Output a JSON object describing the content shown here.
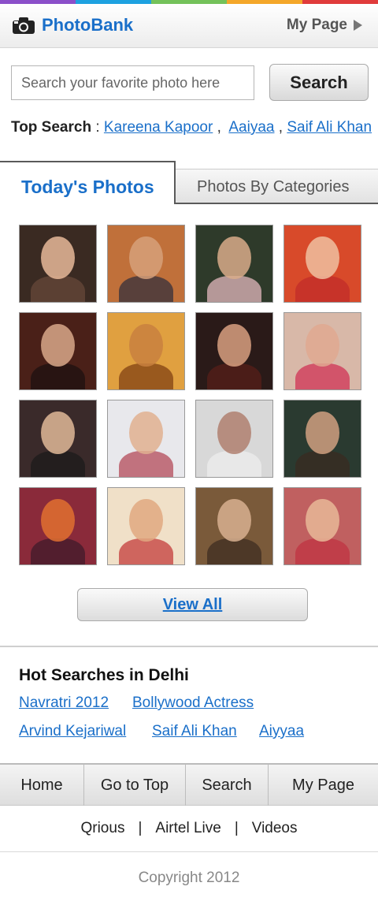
{
  "top_strip_colors": [
    "#8b4fc9",
    "#1da1e0",
    "#74c25a",
    "#f4a72a",
    "#e03b3b"
  ],
  "header": {
    "brand": "PhotoBank",
    "my_page": "My Page"
  },
  "search": {
    "placeholder": "Search your favorite photo here",
    "button_label": "Search"
  },
  "top_search": {
    "label": "Top Search",
    "colon": ":",
    "terms": [
      "Kareena Kapoor",
      "Aaiyaa",
      "Saif Ali Khan"
    ]
  },
  "tabs": [
    {
      "label": "Today's Photos",
      "active": true
    },
    {
      "label": "Photos By Categories",
      "active": false
    }
  ],
  "photos": [
    {
      "bg": "#3a2a22",
      "face": "#e8b999",
      "body": "#6a4a3a"
    },
    {
      "bg": "#c0703a",
      "face": "#d6a07a",
      "body": "#2c2c3c"
    },
    {
      "bg": "#2e3a2a",
      "face": "#d8ab8a",
      "body": "#f0c0c8"
    },
    {
      "bg": "#d84a2a",
      "face": "#f0c0a0",
      "body": "#c02a2a"
    },
    {
      "bg": "#4a2018",
      "face": "#d8a88a",
      "body": "#1a1010"
    },
    {
      "bg": "#e0a040",
      "face": "#c88040",
      "body": "#7a3a10"
    },
    {
      "bg": "#2a1a18",
      "face": "#d8a080",
      "body": "#5a2018"
    },
    {
      "bg": "#d8b8a8",
      "face": "#e0a890",
      "body": "#d02a50"
    },
    {
      "bg": "#3a2a2a",
      "face": "#e0b898",
      "body": "#1a1a1a"
    },
    {
      "bg": "#e8e8ec",
      "face": "#e0b090",
      "body": "#b04050"
    },
    {
      "bg": "#d8d8d8",
      "face": "#b08070",
      "body": "#f0f0f0"
    },
    {
      "bg": "#2a3a30",
      "face": "#d0a080",
      "body": "#3a2a20"
    },
    {
      "bg": "#8a2a3a",
      "face": "#e07030",
      "body": "#3a1a2a"
    },
    {
      "bg": "#f0e0c8",
      "face": "#e0a880",
      "body": "#c03030"
    },
    {
      "bg": "#7a5a3a",
      "face": "#d8b090",
      "body": "#3a2a20"
    },
    {
      "bg": "#c06060",
      "face": "#e8b898",
      "body": "#c03040"
    }
  ],
  "view_all": "View All",
  "hot_searches": {
    "title": "Hot Searches in Delhi",
    "items": [
      "Navratri 2012",
      "Bollywood Actress",
      "Arvind Kejariwal",
      "Saif Ali Khan",
      "Aiyyaa"
    ]
  },
  "bottom_nav": [
    "Home",
    "Go to Top",
    "Search",
    "My Page"
  ],
  "footer_links": [
    "Qrious",
    "Airtel Live",
    "Videos"
  ],
  "footer_separator": "|",
  "copyright": "Copyright  2012",
  "accent_color": "#1a6fc9"
}
